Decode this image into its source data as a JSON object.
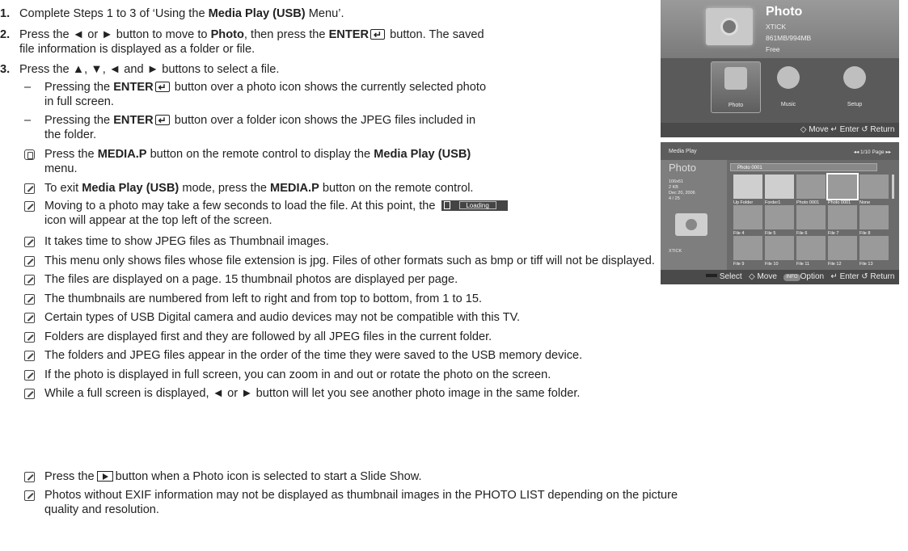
{
  "steps": [
    {
      "num": "1.",
      "pre": "Complete Steps 1 to 3 of ‘Using the ",
      "bold": "Media Play (USB)",
      "post": " Menu’."
    },
    {
      "num": "2.",
      "a": "Press the ◄ or ► button to move to ",
      "b": "Photo",
      "c": ", then press the ",
      "d": "ENTER",
      "e": " button. The saved",
      "cont": "file information is displayed as a folder or file."
    },
    {
      "num": "3.",
      "text": "Press the ▲, ▼, ◄ and ► buttons to select a file."
    }
  ],
  "dashes": [
    {
      "pre": "Pressing the ",
      "bold": "ENTER",
      "post": " button over a photo icon shows the currently selected photo",
      "cont": "in full screen."
    },
    {
      "pre": "Pressing the ",
      "bold": "ENTER",
      "post": " button over a folder icon shows the JPEG files included in",
      "cont": "the folder."
    }
  ],
  "remote_note": {
    "a": "Press the ",
    "b": "MEDIA.P",
    "c": " button on the remote control to display the ",
    "d": "Media Play (USB)",
    "cont": "menu."
  },
  "exit_note": {
    "a": "To exit ",
    "b": "Media Play (USB)",
    "c": " mode, press the ",
    "d": "MEDIA.P",
    "e": " button on the remote control."
  },
  "loading_note": {
    "a": "Moving to a photo may take a few seconds to load the file. At this point, the",
    "icon_label": "Loading",
    "cont": "icon will appear at the top left of the screen."
  },
  "notes": [
    "It takes time to show JPEG files as Thumbnail images.",
    "This menu only shows files whose file extension is jpg. Files of other formats such as bmp or tiff will not be displayed.",
    "The files are displayed on a page. 15 thumbnail photos are displayed per page.",
    "The thumbnails are numbered from left to right and from top to bottom, from 1 to 15.",
    "Certain types of USB Digital camera and audio devices may not be compatible with this TV.",
    "Folders are displayed first and they are followed by all JPEG files in the current folder.",
    "The folders and JPEG files appear in the order of the time they were saved to the USB memory device.",
    "If the photo is displayed in full screen, you can zoom in and out or rotate the photo on the screen.",
    "While a full screen is displayed, ◄ or ► button will let you see another photo image in the same folder."
  ],
  "play_note": {
    "a": "Press the",
    "b": "button when a Photo icon is selected to start a Slide Show."
  },
  "exif_note": {
    "a": "Photos without EXIF information may not be displayed as thumbnail images in the PHOTO LIST depending on the picture",
    "cont": "quality and resolution."
  },
  "screen1": {
    "title": "Photo",
    "device": "XTICK",
    "capacity": "861MB/994MB",
    "free": "Free",
    "menu": [
      "Photo",
      "Music",
      "Setup"
    ],
    "footer": "◇ Move   ↵ Enter   ↺ Return"
  },
  "screen2": {
    "app_title": "Media Play",
    "pager": "◂◂ 1/10 Page ▸▸",
    "side_title": "Photo",
    "side_meta": [
      "106x61",
      "2 KB",
      "Dec 20, 2006",
      "4 / 25"
    ],
    "side_device": "XTICK",
    "path": "Photo 0001",
    "tiles": [
      "Up Folder",
      "Forder1",
      "Photo 0001",
      "Photo 0001",
      "None",
      "File 4",
      "File 5",
      "File 6",
      "File 7",
      "File 8",
      "File 9",
      "File 10",
      "File 11",
      "File 12",
      "File 13"
    ],
    "footer_select": "Select",
    "footer_move": "◇ Move",
    "footer_info": "INFO",
    "footer_option": "Option",
    "footer_rest": "↵ Enter   ↺ Return"
  }
}
